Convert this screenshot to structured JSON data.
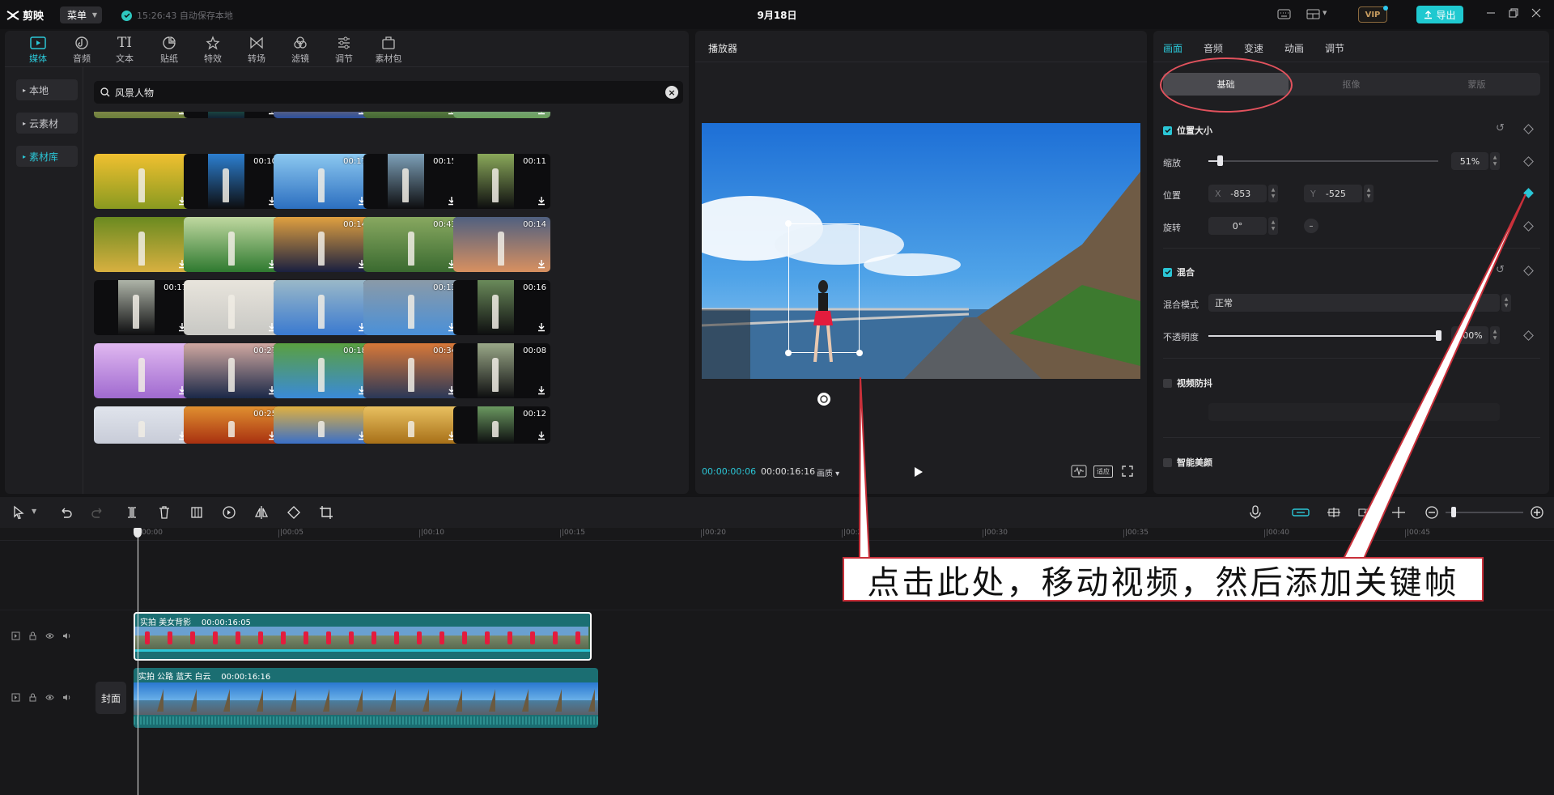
{
  "app": {
    "name": "剪映",
    "menu_label": "菜单",
    "autosave_text": "15:26:43 自动保存本地",
    "project_title": "9月18日",
    "vip_label": "VIP",
    "export_label": "导出"
  },
  "media_tabs": [
    {
      "label": "媒体",
      "icon": "media-icon",
      "active": true
    },
    {
      "label": "音频",
      "icon": "audio-icon"
    },
    {
      "label": "文本",
      "icon": "text-icon"
    },
    {
      "label": "贴纸",
      "icon": "sticker-icon"
    },
    {
      "label": "特效",
      "icon": "effects-icon"
    },
    {
      "label": "转场",
      "icon": "transition-icon"
    },
    {
      "label": "滤镜",
      "icon": "filter-icon"
    },
    {
      "label": "调节",
      "icon": "adjust-icon"
    },
    {
      "label": "素材包",
      "icon": "package-icon"
    }
  ],
  "sidebar": [
    {
      "label": "本地"
    },
    {
      "label": "云素材"
    },
    {
      "label": "素材库",
      "active": true
    }
  ],
  "search": {
    "value": "风景人物"
  },
  "thumbnails": [
    {
      "dur": ""
    },
    {
      "dur": ""
    },
    {
      "dur": ""
    },
    {
      "dur": ""
    },
    {
      "dur": ""
    },
    {
      "dur": ""
    },
    {
      "dur": "00:10"
    },
    {
      "dur": "00:17"
    },
    {
      "dur": "00:15"
    },
    {
      "dur": "00:11"
    },
    {
      "dur": ""
    },
    {
      "dur": ""
    },
    {
      "dur": "00:14"
    },
    {
      "dur": "00:43"
    },
    {
      "dur": "00:14"
    },
    {
      "dur": "00:17"
    },
    {
      "dur": ""
    },
    {
      "dur": ""
    },
    {
      "dur": "00:13"
    },
    {
      "dur": "00:16"
    },
    {
      "dur": ""
    },
    {
      "dur": "00:27"
    },
    {
      "dur": "00:18"
    },
    {
      "dur": "00:34"
    },
    {
      "dur": "00:08"
    },
    {
      "dur": ""
    },
    {
      "dur": "00:25"
    },
    {
      "dur": ""
    },
    {
      "dur": ""
    },
    {
      "dur": "00:12"
    }
  ],
  "player": {
    "title": "播放器",
    "current_time": "00:00:00:06",
    "total_time": "00:00:16:16",
    "ratio_label": "适应",
    "quality_label": "画质"
  },
  "props": {
    "tabs": [
      {
        "label": "画面",
        "active": true
      },
      {
        "label": "音频"
      },
      {
        "label": "变速"
      },
      {
        "label": "动画"
      },
      {
        "label": "调节"
      }
    ],
    "segments": [
      {
        "label": "基础",
        "active": true
      },
      {
        "label": "抠像"
      },
      {
        "label": "蒙版"
      }
    ],
    "position_size": {
      "title": "位置大小",
      "scale_label": "缩放",
      "scale_value": "51%",
      "scale_fraction": 0.05,
      "pos_label": "位置",
      "x_label": "X",
      "x_value": "-853",
      "y_label": "Y",
      "y_value": "-525",
      "rotate_label": "旋转",
      "rotate_value": "0°"
    },
    "blend": {
      "title": "混合",
      "mode_label": "混合模式",
      "mode_value": "正常",
      "opacity_label": "不透明度",
      "opacity_value": "100%",
      "opacity_fraction": 1.0
    },
    "stabilize": {
      "title": "视频防抖"
    },
    "beauty": {
      "title": "智能美颜"
    }
  },
  "timeline": {
    "ruler": [
      "00:00",
      "00:05",
      "00:10",
      "00:15",
      "00:20",
      "00:25",
      "00:30",
      "00:35",
      "00:40",
      "00:45"
    ],
    "clips": [
      {
        "label": "实拍 美女背影",
        "duration": "00:00:16:05"
      },
      {
        "label": "实拍 公路 蓝天 白云",
        "duration": "00:00:16:16"
      }
    ],
    "cover_label": "封面"
  },
  "annotation": "点击此处，移动视频，然后添加关键帧",
  "colors": {
    "accent": "#2bc6d6",
    "callout_border": "#c9303a",
    "clip_teal": "#1b6e72"
  }
}
